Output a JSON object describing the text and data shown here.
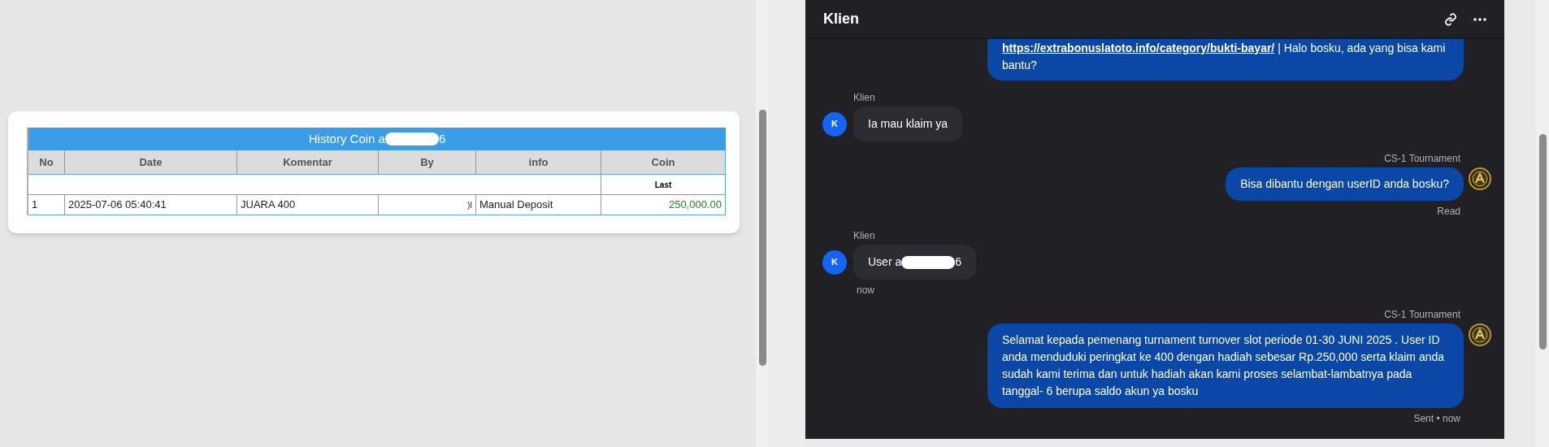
{
  "history_table": {
    "title_start": "History Coin a",
    "title_end": "6",
    "columns": [
      "No",
      "Date",
      "Komentar",
      "By",
      "info",
      "Coin"
    ],
    "subheader": {
      "coin": "Last"
    },
    "rows": [
      {
        "no": "1",
        "date": "2025-07-06 05:40:41",
        "komentar": "JUARA 400",
        "by": ")I",
        "info": "Manual Deposit",
        "coin": "250,000.00"
      }
    ]
  },
  "chat": {
    "title": "Klien",
    "messages": [
      {
        "kind": "agent",
        "link": "https://extrabonuslatoto.info/category/bukti-bayar/",
        "text": "| Halo bosku, ada yang bisa kami bantu?"
      },
      {
        "kind": "client",
        "sender": "Klien",
        "avatar": "K",
        "text": "Ia mau klaim ya"
      },
      {
        "kind": "agent",
        "sender": "CS-1 Tournament",
        "text": "Bisa dibantu dengan userID anda bosku?",
        "status": "Read"
      },
      {
        "kind": "client",
        "sender": "Klien",
        "avatar": "K",
        "text": "User a",
        "text_end": "6",
        "status": "now"
      },
      {
        "kind": "agent",
        "sender": "CS-1 Tournament",
        "text": "Selamat kepada pemenang turnament turnover slot periode 01-30 JUNI 2025 . User ID anda menduduki peringkat ke 400 dengan hadiah sebesar Rp.250,000 serta klaim anda sudah kami terima dan untuk hadiah akan kami proses selambat-lambatnya pada tanggal- 6 berupa saldo akun ya bosku",
        "status": "Sent • now"
      }
    ]
  }
}
